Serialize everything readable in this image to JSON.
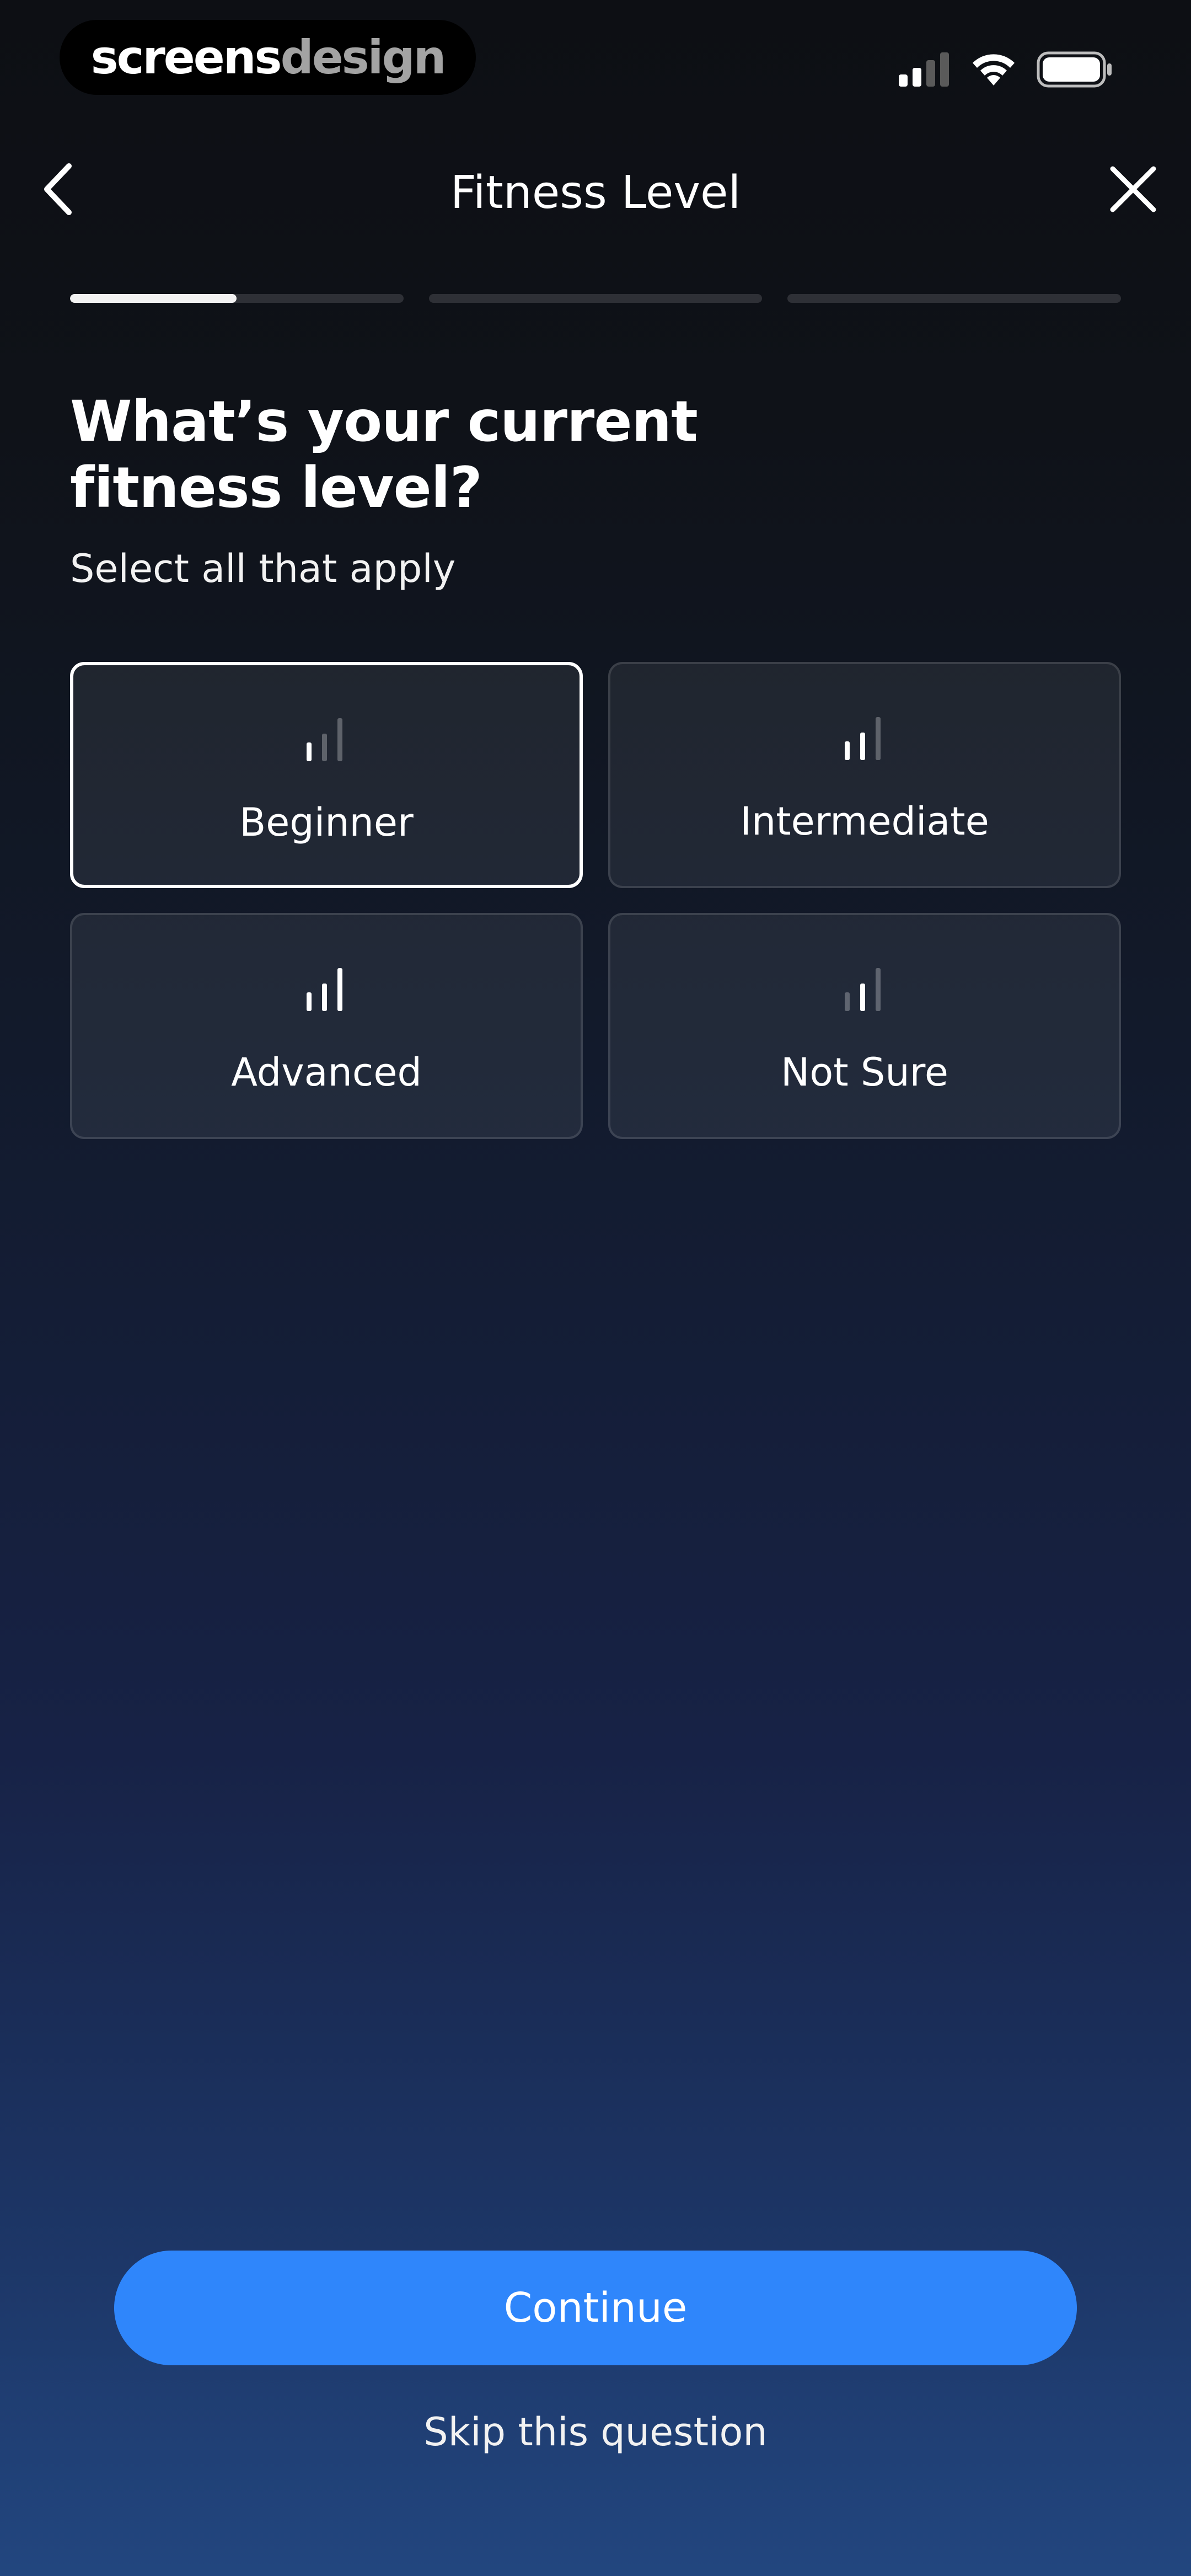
{
  "status_bar": {
    "brand_part1": "screens",
    "brand_part2": "design",
    "icons": [
      "cellular-signal-icon",
      "wifi-icon",
      "battery-icon"
    ]
  },
  "header": {
    "title": "Fitness Level",
    "back_icon": "chevron-left-icon",
    "close_icon": "close-icon"
  },
  "progress": {
    "segments": 3,
    "current_segment": 1,
    "current_segment_fraction": 0.5
  },
  "question": {
    "title": "What’s your current fitness level?",
    "subtitle": "Select all that apply"
  },
  "options": [
    {
      "label": "Beginner",
      "icon": "signal-bars-low-icon",
      "selected": true,
      "level": 1
    },
    {
      "label": "Intermediate",
      "icon": "signal-bars-medium-icon",
      "selected": false,
      "level": 2
    },
    {
      "label": "Advanced",
      "icon": "signal-bars-high-icon",
      "selected": false,
      "level": 3
    },
    {
      "label": "Not Sure",
      "icon": "signal-bars-unsure-icon",
      "selected": false,
      "level": 0
    }
  ],
  "actions": {
    "continue_label": "Continue",
    "skip_label": "Skip this question"
  },
  "colors": {
    "accent": "#2f86fb",
    "selected_border": "#ffffff",
    "progress_active": "#f2f2f2",
    "progress_inactive": "#2e3036"
  }
}
